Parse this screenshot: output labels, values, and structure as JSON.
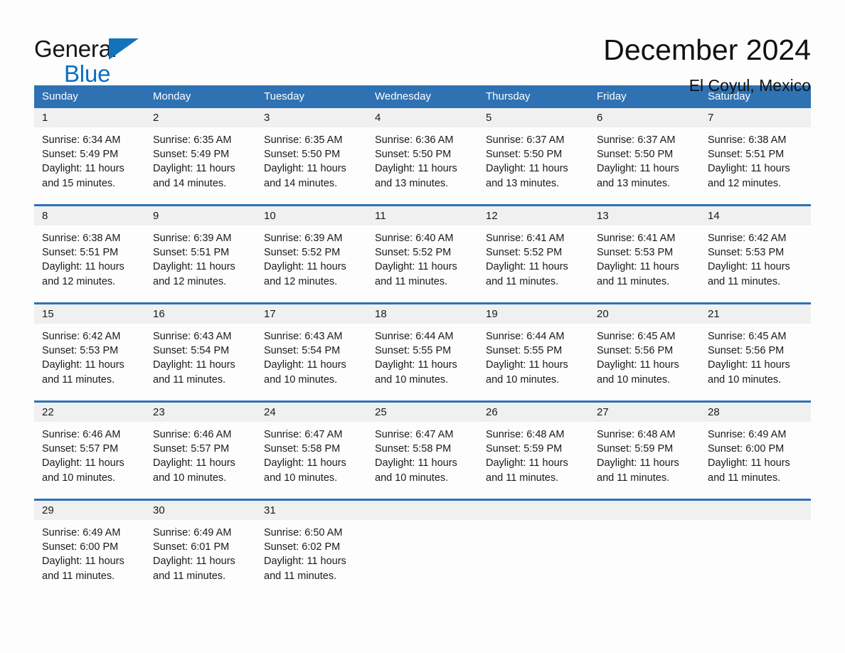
{
  "brand": {
    "line1": "General",
    "line2": "Blue",
    "triangle_color": "#1272bc",
    "blue_text_color": "#0b6ec4"
  },
  "header": {
    "month_title": "December 2024",
    "location": "El Coyul, Mexico"
  },
  "theme": {
    "header_blue": "#2e72b4",
    "daynum_band": "#f0f0f0",
    "page_background": "#fdfdfd",
    "text": "#1a1a1a"
  },
  "weekdays": [
    "Sunday",
    "Monday",
    "Tuesday",
    "Wednesday",
    "Thursday",
    "Friday",
    "Saturday"
  ],
  "weeks": [
    [
      {
        "day": "1",
        "sunrise": "Sunrise: 6:34 AM",
        "sunset": "Sunset: 5:49 PM",
        "daylight_1": "Daylight: 11 hours",
        "daylight_2": "and 15 minutes."
      },
      {
        "day": "2",
        "sunrise": "Sunrise: 6:35 AM",
        "sunset": "Sunset: 5:49 PM",
        "daylight_1": "Daylight: 11 hours",
        "daylight_2": "and 14 minutes."
      },
      {
        "day": "3",
        "sunrise": "Sunrise: 6:35 AM",
        "sunset": "Sunset: 5:50 PM",
        "daylight_1": "Daylight: 11 hours",
        "daylight_2": "and 14 minutes."
      },
      {
        "day": "4",
        "sunrise": "Sunrise: 6:36 AM",
        "sunset": "Sunset: 5:50 PM",
        "daylight_1": "Daylight: 11 hours",
        "daylight_2": "and 13 minutes."
      },
      {
        "day": "5",
        "sunrise": "Sunrise: 6:37 AM",
        "sunset": "Sunset: 5:50 PM",
        "daylight_1": "Daylight: 11 hours",
        "daylight_2": "and 13 minutes."
      },
      {
        "day": "6",
        "sunrise": "Sunrise: 6:37 AM",
        "sunset": "Sunset: 5:50 PM",
        "daylight_1": "Daylight: 11 hours",
        "daylight_2": "and 13 minutes."
      },
      {
        "day": "7",
        "sunrise": "Sunrise: 6:38 AM",
        "sunset": "Sunset: 5:51 PM",
        "daylight_1": "Daylight: 11 hours",
        "daylight_2": "and 12 minutes."
      }
    ],
    [
      {
        "day": "8",
        "sunrise": "Sunrise: 6:38 AM",
        "sunset": "Sunset: 5:51 PM",
        "daylight_1": "Daylight: 11 hours",
        "daylight_2": "and 12 minutes."
      },
      {
        "day": "9",
        "sunrise": "Sunrise: 6:39 AM",
        "sunset": "Sunset: 5:51 PM",
        "daylight_1": "Daylight: 11 hours",
        "daylight_2": "and 12 minutes."
      },
      {
        "day": "10",
        "sunrise": "Sunrise: 6:39 AM",
        "sunset": "Sunset: 5:52 PM",
        "daylight_1": "Daylight: 11 hours",
        "daylight_2": "and 12 minutes."
      },
      {
        "day": "11",
        "sunrise": "Sunrise: 6:40 AM",
        "sunset": "Sunset: 5:52 PM",
        "daylight_1": "Daylight: 11 hours",
        "daylight_2": "and 11 minutes."
      },
      {
        "day": "12",
        "sunrise": "Sunrise: 6:41 AM",
        "sunset": "Sunset: 5:52 PM",
        "daylight_1": "Daylight: 11 hours",
        "daylight_2": "and 11 minutes."
      },
      {
        "day": "13",
        "sunrise": "Sunrise: 6:41 AM",
        "sunset": "Sunset: 5:53 PM",
        "daylight_1": "Daylight: 11 hours",
        "daylight_2": "and 11 minutes."
      },
      {
        "day": "14",
        "sunrise": "Sunrise: 6:42 AM",
        "sunset": "Sunset: 5:53 PM",
        "daylight_1": "Daylight: 11 hours",
        "daylight_2": "and 11 minutes."
      }
    ],
    [
      {
        "day": "15",
        "sunrise": "Sunrise: 6:42 AM",
        "sunset": "Sunset: 5:53 PM",
        "daylight_1": "Daylight: 11 hours",
        "daylight_2": "and 11 minutes."
      },
      {
        "day": "16",
        "sunrise": "Sunrise: 6:43 AM",
        "sunset": "Sunset: 5:54 PM",
        "daylight_1": "Daylight: 11 hours",
        "daylight_2": "and 11 minutes."
      },
      {
        "day": "17",
        "sunrise": "Sunrise: 6:43 AM",
        "sunset": "Sunset: 5:54 PM",
        "daylight_1": "Daylight: 11 hours",
        "daylight_2": "and 10 minutes."
      },
      {
        "day": "18",
        "sunrise": "Sunrise: 6:44 AM",
        "sunset": "Sunset: 5:55 PM",
        "daylight_1": "Daylight: 11 hours",
        "daylight_2": "and 10 minutes."
      },
      {
        "day": "19",
        "sunrise": "Sunrise: 6:44 AM",
        "sunset": "Sunset: 5:55 PM",
        "daylight_1": "Daylight: 11 hours",
        "daylight_2": "and 10 minutes."
      },
      {
        "day": "20",
        "sunrise": "Sunrise: 6:45 AM",
        "sunset": "Sunset: 5:56 PM",
        "daylight_1": "Daylight: 11 hours",
        "daylight_2": "and 10 minutes."
      },
      {
        "day": "21",
        "sunrise": "Sunrise: 6:45 AM",
        "sunset": "Sunset: 5:56 PM",
        "daylight_1": "Daylight: 11 hours",
        "daylight_2": "and 10 minutes."
      }
    ],
    [
      {
        "day": "22",
        "sunrise": "Sunrise: 6:46 AM",
        "sunset": "Sunset: 5:57 PM",
        "daylight_1": "Daylight: 11 hours",
        "daylight_2": "and 10 minutes."
      },
      {
        "day": "23",
        "sunrise": "Sunrise: 6:46 AM",
        "sunset": "Sunset: 5:57 PM",
        "daylight_1": "Daylight: 11 hours",
        "daylight_2": "and 10 minutes."
      },
      {
        "day": "24",
        "sunrise": "Sunrise: 6:47 AM",
        "sunset": "Sunset: 5:58 PM",
        "daylight_1": "Daylight: 11 hours",
        "daylight_2": "and 10 minutes."
      },
      {
        "day": "25",
        "sunrise": "Sunrise: 6:47 AM",
        "sunset": "Sunset: 5:58 PM",
        "daylight_1": "Daylight: 11 hours",
        "daylight_2": "and 10 minutes."
      },
      {
        "day": "26",
        "sunrise": "Sunrise: 6:48 AM",
        "sunset": "Sunset: 5:59 PM",
        "daylight_1": "Daylight: 11 hours",
        "daylight_2": "and 11 minutes."
      },
      {
        "day": "27",
        "sunrise": "Sunrise: 6:48 AM",
        "sunset": "Sunset: 5:59 PM",
        "daylight_1": "Daylight: 11 hours",
        "daylight_2": "and 11 minutes."
      },
      {
        "day": "28",
        "sunrise": "Sunrise: 6:49 AM",
        "sunset": "Sunset: 6:00 PM",
        "daylight_1": "Daylight: 11 hours",
        "daylight_2": "and 11 minutes."
      }
    ],
    [
      {
        "day": "29",
        "sunrise": "Sunrise: 6:49 AM",
        "sunset": "Sunset: 6:00 PM",
        "daylight_1": "Daylight: 11 hours",
        "daylight_2": "and 11 minutes."
      },
      {
        "day": "30",
        "sunrise": "Sunrise: 6:49 AM",
        "sunset": "Sunset: 6:01 PM",
        "daylight_1": "Daylight: 11 hours",
        "daylight_2": "and 11 minutes."
      },
      {
        "day": "31",
        "sunrise": "Sunrise: 6:50 AM",
        "sunset": "Sunset: 6:02 PM",
        "daylight_1": "Daylight: 11 hours",
        "daylight_2": "and 11 minutes."
      },
      {
        "day": "",
        "sunrise": "",
        "sunset": "",
        "daylight_1": "",
        "daylight_2": ""
      },
      {
        "day": "",
        "sunrise": "",
        "sunset": "",
        "daylight_1": "",
        "daylight_2": ""
      },
      {
        "day": "",
        "sunrise": "",
        "sunset": "",
        "daylight_1": "",
        "daylight_2": ""
      },
      {
        "day": "",
        "sunrise": "",
        "sunset": "",
        "daylight_1": "",
        "daylight_2": ""
      }
    ]
  ]
}
